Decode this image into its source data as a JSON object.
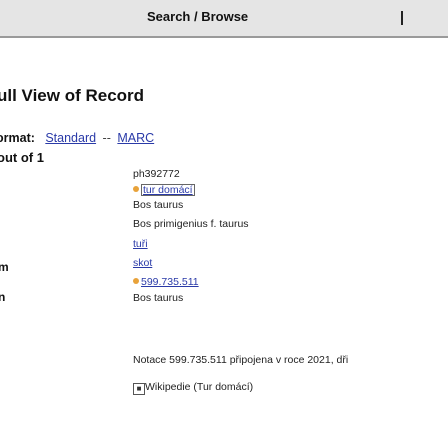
{
  "header": {
    "title": "Search / Browse"
  },
  "page": {
    "title": "ull View of Record",
    "format_label": "ormat:",
    "format_options": [
      "Standard",
      "MARC"
    ],
    "format_separator": "--",
    "record_count": "out of 1",
    "left_fragments": [
      "m",
      "n"
    ]
  },
  "record": {
    "id": "ph392772",
    "tag_link": "tur domácí",
    "lines": [
      "Bos taurus",
      "Bos primigenius f. taurus",
      "tuři",
      "skot",
      "599.735.511",
      "Bos taurus"
    ],
    "notation": "Notace 599.735.511 připojena v roce 2021, dři",
    "source_link": "Wikipedie (Tur domácí)"
  }
}
